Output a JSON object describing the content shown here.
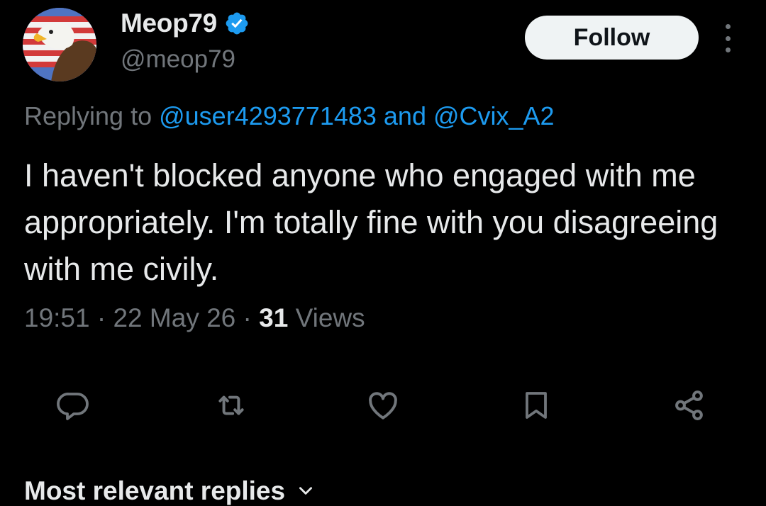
{
  "author": {
    "display_name": "Meop79",
    "handle": "@meop79",
    "verified": true
  },
  "follow_label": "Follow",
  "reply_context": {
    "prefix": "Replying to ",
    "mention_1": "@user4293771483",
    "connector": " and ",
    "mention_2": "@Cvix_A2"
  },
  "tweet": {
    "text": "I haven't blocked anyone who engaged with me appropriately.  I'm totally fine with you disagreeing with me civily."
  },
  "meta": {
    "time": "19:51",
    "separator": " · ",
    "date": "22 May 26",
    "views_count": "31",
    "views_label": " Views"
  },
  "actions": [
    "reply-icon",
    "retweet-icon",
    "like-icon",
    "bookmark-icon",
    "share-icon"
  ],
  "replies_section": {
    "label": "Most relevant replies"
  },
  "colors": {
    "background": "#000000",
    "text": "#e7e9ea",
    "secondary": "#71767b",
    "link": "#1d9bf0",
    "button_bg": "#eff3f4"
  }
}
